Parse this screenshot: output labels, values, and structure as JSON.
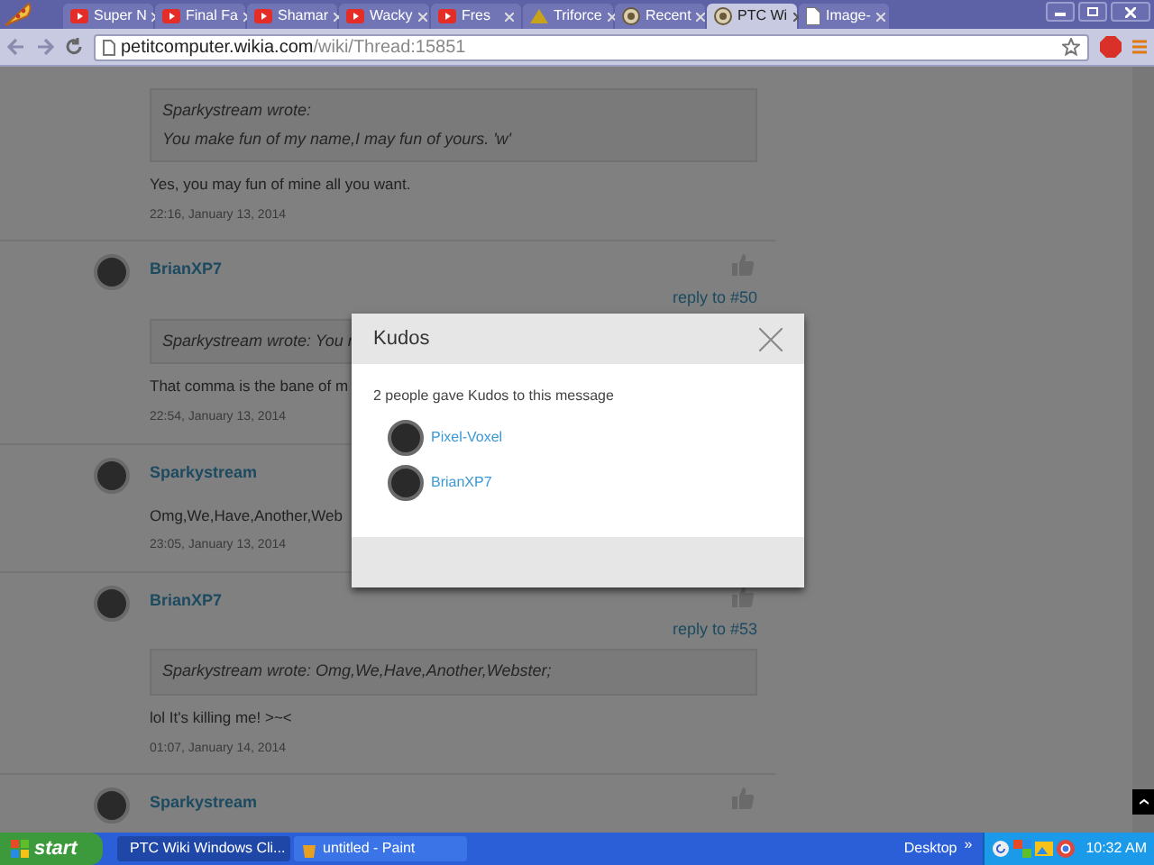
{
  "browser": {
    "tabs": [
      {
        "label": "Super N",
        "kind": "video",
        "selected": false
      },
      {
        "label": "Final Fa",
        "kind": "video",
        "selected": false
      },
      {
        "label": "Shamar",
        "kind": "video",
        "selected": false
      },
      {
        "label": "Wacky",
        "kind": "video",
        "selected": false
      },
      {
        "label": "Fres",
        "kind": "video",
        "selected": false
      },
      {
        "label": "Triforce",
        "kind": "site",
        "selected": false
      },
      {
        "label": "Recent",
        "kind": "wiki",
        "selected": false
      },
      {
        "label": "PTC Wi",
        "kind": "wiki",
        "selected": true
      },
      {
        "label": "Image-",
        "kind": "page",
        "selected": false
      }
    ],
    "address": {
      "host": "petitcomputer.wikia.com",
      "path": "/wiki/Thread:15851"
    }
  },
  "thread": {
    "posts": [
      {
        "quote": [
          "Sparkystream wrote:",
          "You make fun of my name,I may fun of yours. 'w'"
        ],
        "body": "Yes, you may fun of mine all you want.",
        "time": "22:16, January 13, 2014"
      },
      {
        "author": "BrianXP7",
        "reply_to": "reply to #50",
        "quote": [
          "Sparkystream wrote: You r"
        ],
        "body": "That comma is the bane of m",
        "time": "22:54, January 13, 2014"
      },
      {
        "author": "Sparkystream",
        "body": "Omg,We,Have,Another,Web",
        "time": "23:05, January 13, 2014"
      },
      {
        "author": "BrianXP7",
        "reply_to": "reply to #53",
        "quote": [
          "Sparkystream wrote: Omg,We,Have,Another,Webster;"
        ],
        "body": "lol It's killing me! >~<",
        "time": "01:07, January 14, 2014"
      },
      {
        "author": "Sparkystream"
      }
    ]
  },
  "kudos_dialog": {
    "title": "Kudos",
    "message": "2 people gave Kudos to this message",
    "users": [
      "Pixel-Voxel",
      "BrianXP7"
    ]
  },
  "taskbar": {
    "start": "start",
    "tasks": [
      {
        "label": "PTC Wiki Windows Cli...",
        "kind": "browser",
        "selected": true
      },
      {
        "label": "untitled - Paint",
        "kind": "paint",
        "selected": false
      }
    ],
    "toolbar": "Desktop",
    "chevron": "»",
    "clock": "10:32 AM"
  }
}
